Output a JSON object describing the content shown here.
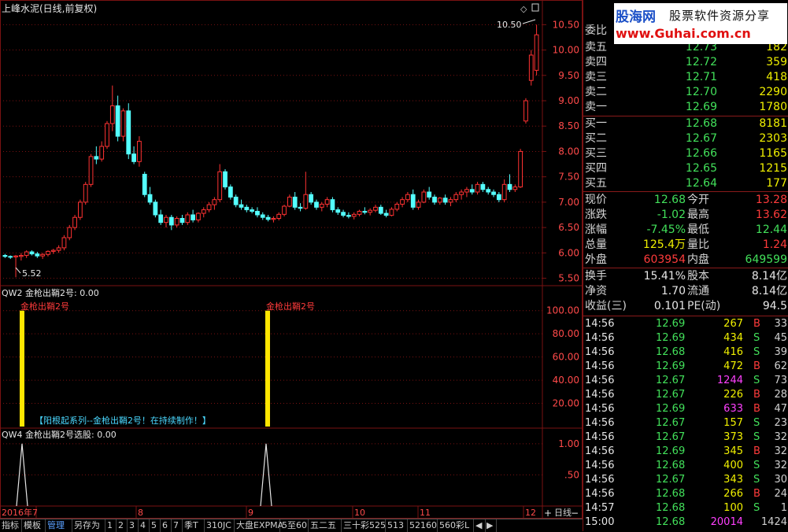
{
  "main_chart": {
    "title": "上峰水泥(日线,前复权)",
    "high_label": "10.50",
    "low_label": "5.52",
    "yaxis_ticks": [
      "10.50",
      "10.00",
      "9.50",
      "9.00",
      "8.50",
      "8.00",
      "7.50",
      "7.00",
      "6.50",
      "6.00",
      "5.50"
    ]
  },
  "ind1": {
    "title": "QW2 金枪出鞘2号: 0.00",
    "signal_text": "金枪出鞘2号",
    "banner": "【阳根起系列--金枪出鞘2号！在持续制作！】",
    "yaxis_ticks": [
      "100.00",
      "80.00",
      "60.00",
      "40.00",
      "20.00"
    ]
  },
  "ind2": {
    "title": "QW4 金枪出鞘2号选股: 0.00",
    "yaxis_ticks": [
      "1.00",
      ".50"
    ]
  },
  "xaxis": {
    "labels": [
      "2016年7",
      "8",
      "9",
      "10",
      "11",
      "12"
    ],
    "period": "日线"
  },
  "chart_data": {
    "type": "candlestick",
    "title": "上峰水泥(日线,前复权)",
    "ylim": [
      5.4,
      10.8
    ],
    "annotated_high": 10.5,
    "annotated_low": 5.52,
    "candles": [
      {
        "o": 5.95,
        "h": 5.98,
        "l": 5.9,
        "c": 5.93
      },
      {
        "o": 5.93,
        "h": 5.95,
        "l": 5.88,
        "c": 5.92
      },
      {
        "o": 5.92,
        "h": 5.96,
        "l": 5.52,
        "c": 5.94
      },
      {
        "o": 5.93,
        "h": 6.0,
        "l": 5.85,
        "c": 5.95
      },
      {
        "o": 5.95,
        "h": 6.05,
        "l": 5.9,
        "c": 6.02
      },
      {
        "o": 6.02,
        "h": 6.05,
        "l": 5.95,
        "c": 5.98
      },
      {
        "o": 5.98,
        "h": 6.02,
        "l": 5.9,
        "c": 5.94
      },
      {
        "o": 5.94,
        "h": 6.0,
        "l": 5.88,
        "c": 5.97
      },
      {
        "o": 5.97,
        "h": 6.05,
        "l": 5.93,
        "c": 6.03
      },
      {
        "o": 6.03,
        "h": 6.08,
        "l": 5.98,
        "c": 6.05
      },
      {
        "o": 6.05,
        "h": 6.15,
        "l": 6.0,
        "c": 6.1
      },
      {
        "o": 6.1,
        "h": 6.35,
        "l": 6.05,
        "c": 6.3
      },
      {
        "o": 6.3,
        "h": 6.55,
        "l": 6.25,
        "c": 6.5
      },
      {
        "o": 6.5,
        "h": 6.75,
        "l": 6.45,
        "c": 6.7
      },
      {
        "o": 6.7,
        "h": 7.05,
        "l": 6.65,
        "c": 7.0
      },
      {
        "o": 7.0,
        "h": 7.4,
        "l": 6.95,
        "c": 7.35
      },
      {
        "o": 7.35,
        "h": 7.95,
        "l": 7.3,
        "c": 7.9
      },
      {
        "o": 7.9,
        "h": 8.1,
        "l": 7.75,
        "c": 7.85
      },
      {
        "o": 7.85,
        "h": 8.2,
        "l": 7.8,
        "c": 8.1
      },
      {
        "o": 8.1,
        "h": 8.6,
        "l": 8.05,
        "c": 8.55
      },
      {
        "o": 8.55,
        "h": 9.3,
        "l": 8.4,
        "c": 8.9
      },
      {
        "o": 8.9,
        "h": 9.1,
        "l": 8.2,
        "c": 8.3
      },
      {
        "o": 8.3,
        "h": 8.85,
        "l": 8.2,
        "c": 8.8
      },
      {
        "o": 8.8,
        "h": 8.95,
        "l": 7.85,
        "c": 7.95
      },
      {
        "o": 7.95,
        "h": 8.1,
        "l": 7.75,
        "c": 7.8
      },
      {
        "o": 7.8,
        "h": 8.3,
        "l": 7.7,
        "c": 8.2
      },
      {
        "o": 7.55,
        "h": 7.6,
        "l": 7.1,
        "c": 7.15
      },
      {
        "o": 7.15,
        "h": 7.3,
        "l": 6.95,
        "c": 7.0
      },
      {
        "o": 7.0,
        "h": 7.05,
        "l": 6.7,
        "c": 6.75
      },
      {
        "o": 6.75,
        "h": 6.85,
        "l": 6.55,
        "c": 6.6
      },
      {
        "o": 6.6,
        "h": 6.75,
        "l": 6.5,
        "c": 6.7
      },
      {
        "o": 6.7,
        "h": 6.75,
        "l": 6.45,
        "c": 6.55
      },
      {
        "o": 6.55,
        "h": 6.72,
        "l": 6.5,
        "c": 6.68
      },
      {
        "o": 6.68,
        "h": 6.75,
        "l": 6.55,
        "c": 6.6
      },
      {
        "o": 6.6,
        "h": 6.8,
        "l": 6.55,
        "c": 6.75
      },
      {
        "o": 6.75,
        "h": 6.85,
        "l": 6.6,
        "c": 6.65
      },
      {
        "o": 6.65,
        "h": 6.8,
        "l": 6.6,
        "c": 6.78
      },
      {
        "o": 6.78,
        "h": 6.9,
        "l": 6.7,
        "c": 6.85
      },
      {
        "o": 6.85,
        "h": 7.0,
        "l": 6.8,
        "c": 6.95
      },
      {
        "o": 6.95,
        "h": 7.1,
        "l": 6.85,
        "c": 7.05
      },
      {
        "o": 7.05,
        "h": 7.75,
        "l": 7.0,
        "c": 7.6
      },
      {
        "o": 7.6,
        "h": 7.65,
        "l": 7.25,
        "c": 7.3
      },
      {
        "o": 7.3,
        "h": 7.35,
        "l": 7.05,
        "c": 7.1
      },
      {
        "o": 7.1,
        "h": 7.15,
        "l": 6.9,
        "c": 6.95
      },
      {
        "o": 6.95,
        "h": 7.05,
        "l": 6.85,
        "c": 6.9
      },
      {
        "o": 6.9,
        "h": 6.95,
        "l": 6.8,
        "c": 6.85
      },
      {
        "o": 6.85,
        "h": 6.9,
        "l": 6.78,
        "c": 6.82
      },
      {
        "o": 6.82,
        "h": 6.9,
        "l": 6.7,
        "c": 6.75
      },
      {
        "o": 6.75,
        "h": 6.8,
        "l": 6.65,
        "c": 6.7
      },
      {
        "o": 6.7,
        "h": 6.75,
        "l": 6.62,
        "c": 6.66
      },
      {
        "o": 6.66,
        "h": 6.72,
        "l": 6.6,
        "c": 6.68
      },
      {
        "o": 6.68,
        "h": 6.8,
        "l": 6.64,
        "c": 6.76
      },
      {
        "o": 6.76,
        "h": 6.95,
        "l": 6.72,
        "c": 6.92
      },
      {
        "o": 6.92,
        "h": 7.15,
        "l": 6.9,
        "c": 7.1
      },
      {
        "o": 7.1,
        "h": 7.2,
        "l": 6.85,
        "c": 6.9
      },
      {
        "o": 6.9,
        "h": 6.98,
        "l": 6.82,
        "c": 6.88
      },
      {
        "o": 6.88,
        "h": 7.6,
        "l": 6.85,
        "c": 7.15
      },
      {
        "o": 7.15,
        "h": 7.2,
        "l": 6.95,
        "c": 7.0
      },
      {
        "o": 7.0,
        "h": 7.05,
        "l": 6.85,
        "c": 6.9
      },
      {
        "o": 6.9,
        "h": 7.0,
        "l": 6.82,
        "c": 6.96
      },
      {
        "o": 6.96,
        "h": 7.1,
        "l": 6.9,
        "c": 7.05
      },
      {
        "o": 7.05,
        "h": 7.1,
        "l": 6.8,
        "c": 6.85
      },
      {
        "o": 6.85,
        "h": 6.9,
        "l": 6.75,
        "c": 6.8
      },
      {
        "o": 6.8,
        "h": 6.85,
        "l": 6.7,
        "c": 6.74
      },
      {
        "o": 6.74,
        "h": 6.8,
        "l": 6.68,
        "c": 6.72
      },
      {
        "o": 6.72,
        "h": 6.8,
        "l": 6.66,
        "c": 6.76
      },
      {
        "o": 6.76,
        "h": 6.85,
        "l": 6.72,
        "c": 6.82
      },
      {
        "o": 6.82,
        "h": 6.9,
        "l": 6.76,
        "c": 6.8
      },
      {
        "o": 6.8,
        "h": 6.88,
        "l": 6.74,
        "c": 6.84
      },
      {
        "o": 6.84,
        "h": 6.95,
        "l": 6.8,
        "c": 6.9
      },
      {
        "o": 6.9,
        "h": 6.95,
        "l": 6.75,
        "c": 6.78
      },
      {
        "o": 6.78,
        "h": 6.85,
        "l": 6.7,
        "c": 6.74
      },
      {
        "o": 6.74,
        "h": 6.9,
        "l": 6.72,
        "c": 6.86
      },
      {
        "o": 6.86,
        "h": 7.0,
        "l": 6.82,
        "c": 6.96
      },
      {
        "o": 6.96,
        "h": 7.1,
        "l": 6.9,
        "c": 7.05
      },
      {
        "o": 7.05,
        "h": 7.2,
        "l": 7.0,
        "c": 7.15
      },
      {
        "o": 7.15,
        "h": 7.25,
        "l": 6.85,
        "c": 6.9
      },
      {
        "o": 6.9,
        "h": 7.05,
        "l": 6.85,
        "c": 7.0
      },
      {
        "o": 7.0,
        "h": 7.25,
        "l": 6.98,
        "c": 7.2
      },
      {
        "o": 7.2,
        "h": 7.3,
        "l": 7.05,
        "c": 7.1
      },
      {
        "o": 7.1,
        "h": 7.15,
        "l": 6.95,
        "c": 7.0
      },
      {
        "o": 7.0,
        "h": 7.1,
        "l": 6.95,
        "c": 7.08
      },
      {
        "o": 7.08,
        "h": 7.15,
        "l": 6.95,
        "c": 7.0
      },
      {
        "o": 7.0,
        "h": 7.1,
        "l": 6.92,
        "c": 7.05
      },
      {
        "o": 7.05,
        "h": 7.2,
        "l": 7.0,
        "c": 7.15
      },
      {
        "o": 7.15,
        "h": 7.25,
        "l": 7.05,
        "c": 7.2
      },
      {
        "o": 7.2,
        "h": 7.3,
        "l": 7.1,
        "c": 7.25
      },
      {
        "o": 7.25,
        "h": 7.35,
        "l": 7.15,
        "c": 7.2
      },
      {
        "o": 7.2,
        "h": 7.4,
        "l": 7.15,
        "c": 7.35
      },
      {
        "o": 7.35,
        "h": 7.4,
        "l": 7.2,
        "c": 7.25
      },
      {
        "o": 7.25,
        "h": 7.3,
        "l": 7.15,
        "c": 7.2
      },
      {
        "o": 7.2,
        "h": 7.25,
        "l": 7.1,
        "c": 7.15
      },
      {
        "o": 7.15,
        "h": 7.2,
        "l": 7.0,
        "c": 7.05
      },
      {
        "o": 7.05,
        "h": 7.45,
        "l": 7.0,
        "c": 7.35
      },
      {
        "o": 7.35,
        "h": 7.55,
        "l": 7.2,
        "c": 7.25
      },
      {
        "o": 7.25,
        "h": 7.35,
        "l": 7.2,
        "c": 7.3
      },
      {
        "o": 7.3,
        "h": 8.05,
        "l": 7.28,
        "c": 8.0
      },
      {
        "o": 8.6,
        "h": 9.05,
        "l": 8.55,
        "c": 9.0
      },
      {
        "o": 9.4,
        "h": 10.0,
        "l": 9.3,
        "c": 9.9
      },
      {
        "o": 9.6,
        "h": 10.5,
        "l": 9.5,
        "c": 10.3
      }
    ]
  },
  "signals": {
    "ind1_bars_at_candle": [
      3,
      44
    ],
    "ind1_bar_value": 100,
    "ind2_peaks_at_candle": [
      3,
      44
    ],
    "ind2_peak_value": 1
  },
  "logo": {
    "line1_a": "股海网",
    "line1_b": "股票软件资源分享",
    "line2": "www.Guhai.com.cn"
  },
  "quote": {
    "weibi_label": "委比",
    "asks": [
      {
        "label": "卖五",
        "price": "12.73",
        "vol": "182"
      },
      {
        "label": "卖四",
        "price": "12.72",
        "vol": "359"
      },
      {
        "label": "卖三",
        "price": "12.71",
        "vol": "418"
      },
      {
        "label": "卖二",
        "price": "12.70",
        "vol": "2290"
      },
      {
        "label": "卖一",
        "price": "12.69",
        "vol": "1780"
      }
    ],
    "bids": [
      {
        "label": "买一",
        "price": "12.68",
        "vol": "8181"
      },
      {
        "label": "买二",
        "price": "12.67",
        "vol": "2303"
      },
      {
        "label": "买三",
        "price": "12.66",
        "vol": "1165"
      },
      {
        "label": "买四",
        "price": "12.65",
        "vol": "1215"
      },
      {
        "label": "买五",
        "price": "12.64",
        "vol": "177"
      }
    ],
    "stats1": [
      {
        "l1": "现价",
        "v1": "12.68",
        "c1": "green",
        "l2": "今开",
        "v2": "13.28",
        "c2": "red"
      },
      {
        "l1": "涨跌",
        "v1": "-1.02",
        "c1": "green",
        "l2": "最高",
        "v2": "13.62",
        "c2": "red"
      },
      {
        "l1": "涨幅",
        "v1": "-7.45%",
        "c1": "green",
        "l2": "最低",
        "v2": "12.44",
        "c2": "green"
      },
      {
        "l1": "总量",
        "v1": "125.4万",
        "c1": "yellow",
        "l2": "量比",
        "v2": "1.24",
        "c2": "red"
      },
      {
        "l1": "外盘",
        "v1": "603954",
        "c1": "red",
        "l2": "内盘",
        "v2": "649599",
        "c2": "green"
      }
    ],
    "stats2": [
      {
        "l1": "换手",
        "v1": "15.41%",
        "l2": "股本",
        "v2": "8.14亿"
      },
      {
        "l1": "净资",
        "v1": "1.70",
        "l2": "流通",
        "v2": "8.14亿"
      },
      {
        "l1": "收益(三)",
        "v1": "0.101",
        "l2": "PE(动)",
        "v2": "94.5"
      }
    ]
  },
  "ticks": [
    {
      "time": "14:56",
      "price": "12.69",
      "vol": "267",
      "bs": "B",
      "n": "33"
    },
    {
      "time": "14:56",
      "price": "12.69",
      "vol": "434",
      "bs": "S",
      "n": "45"
    },
    {
      "time": "14:56",
      "price": "12.68",
      "vol": "416",
      "bs": "S",
      "n": "39"
    },
    {
      "time": "14:56",
      "price": "12.69",
      "vol": "472",
      "bs": "B",
      "n": "62"
    },
    {
      "time": "14:56",
      "price": "12.67",
      "vol": "1244",
      "bs": "S",
      "n": "73"
    },
    {
      "time": "14:56",
      "price": "12.67",
      "vol": "226",
      "bs": "B",
      "n": "28"
    },
    {
      "time": "14:56",
      "price": "12.69",
      "vol": "633",
      "bs": "B",
      "n": "47"
    },
    {
      "time": "14:56",
      "price": "12.67",
      "vol": "157",
      "bs": "S",
      "n": "23"
    },
    {
      "time": "14:56",
      "price": "12.67",
      "vol": "373",
      "bs": "S",
      "n": "32"
    },
    {
      "time": "14:56",
      "price": "12.69",
      "vol": "345",
      "bs": "B",
      "n": "32"
    },
    {
      "time": "14:56",
      "price": "12.68",
      "vol": "400",
      "bs": "S",
      "n": "32"
    },
    {
      "time": "14:56",
      "price": "12.67",
      "vol": "343",
      "bs": "S",
      "n": "30"
    },
    {
      "time": "14:56",
      "price": "12.68",
      "vol": "266",
      "bs": "B",
      "n": "24"
    },
    {
      "time": "14:57",
      "price": "12.68",
      "vol": "100",
      "bs": "S",
      "n": "1"
    },
    {
      "time": "15:00",
      "price": "12.68",
      "vol": "20014",
      "bs": "",
      "n": "1424"
    }
  ],
  "bottom_tabs": [
    "指标",
    "模板",
    "管理",
    "另存为",
    "1",
    "2",
    "3",
    "4",
    "5",
    "6",
    "7",
    "季T",
    "310JC",
    "大盘EXPMA",
    "5至60",
    "五二五",
    "三十彩525",
    "513",
    "52160",
    "560彩L"
  ],
  "colors": {
    "up": "#ff3232",
    "down": "#54ffff",
    "grid": "#7a1212",
    "signal_bar": "#ffe600",
    "signal_line": "#e6e6e6"
  }
}
